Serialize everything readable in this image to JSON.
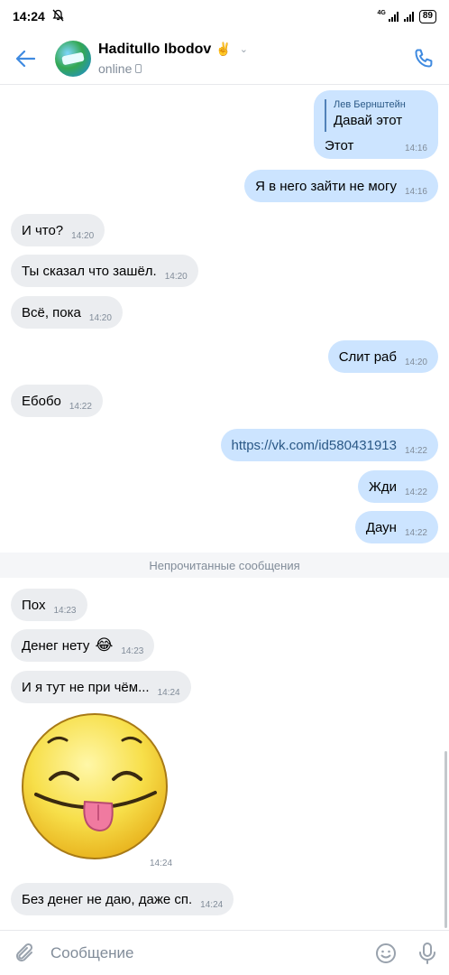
{
  "status_bar": {
    "time": "14:24",
    "network": "4G",
    "battery": "89"
  },
  "header": {
    "name": "Haditullo Ibodov",
    "name_emoji": "✌️",
    "status": "online"
  },
  "reply": {
    "author": "Лев Бернштейн",
    "quoted": "Давай этот",
    "text": "Этот",
    "time": "14:16"
  },
  "messages": [
    {
      "dir": "out",
      "text": "Я в него зайти не могу",
      "time": "14:16"
    },
    {
      "dir": "in",
      "text": "И что?",
      "time": "14:20"
    },
    {
      "dir": "in",
      "text": "Ты сказал что зашёл.",
      "time": "14:20"
    },
    {
      "dir": "in",
      "text": "Всё, пока",
      "time": "14:20"
    },
    {
      "dir": "out",
      "text": "Слит раб",
      "time": "14:20"
    },
    {
      "dir": "in",
      "text": "Ебобо",
      "time": "14:22"
    },
    {
      "dir": "out",
      "text": "https://vk.com/id580431913",
      "time": "14:22"
    },
    {
      "dir": "out",
      "text": "Жди",
      "time": "14:22"
    },
    {
      "dir": "out",
      "text": "Даун",
      "time": "14:22"
    },
    {
      "dir": "in",
      "text": "Пох",
      "time": "14:23"
    },
    {
      "dir": "in",
      "text": "Денег нету",
      "emoji": "😂",
      "time": "14:23"
    },
    {
      "dir": "in",
      "text": "И я тут не при чём...",
      "time": "14:24"
    },
    {
      "dir": "in",
      "text": "Без денег не даю, даже сп.",
      "time": "14:24"
    }
  ],
  "unread_divider": "Непрочитанные сообщения",
  "sticker": {
    "time": "14:24"
  },
  "composer": {
    "placeholder": "Сообщение"
  }
}
